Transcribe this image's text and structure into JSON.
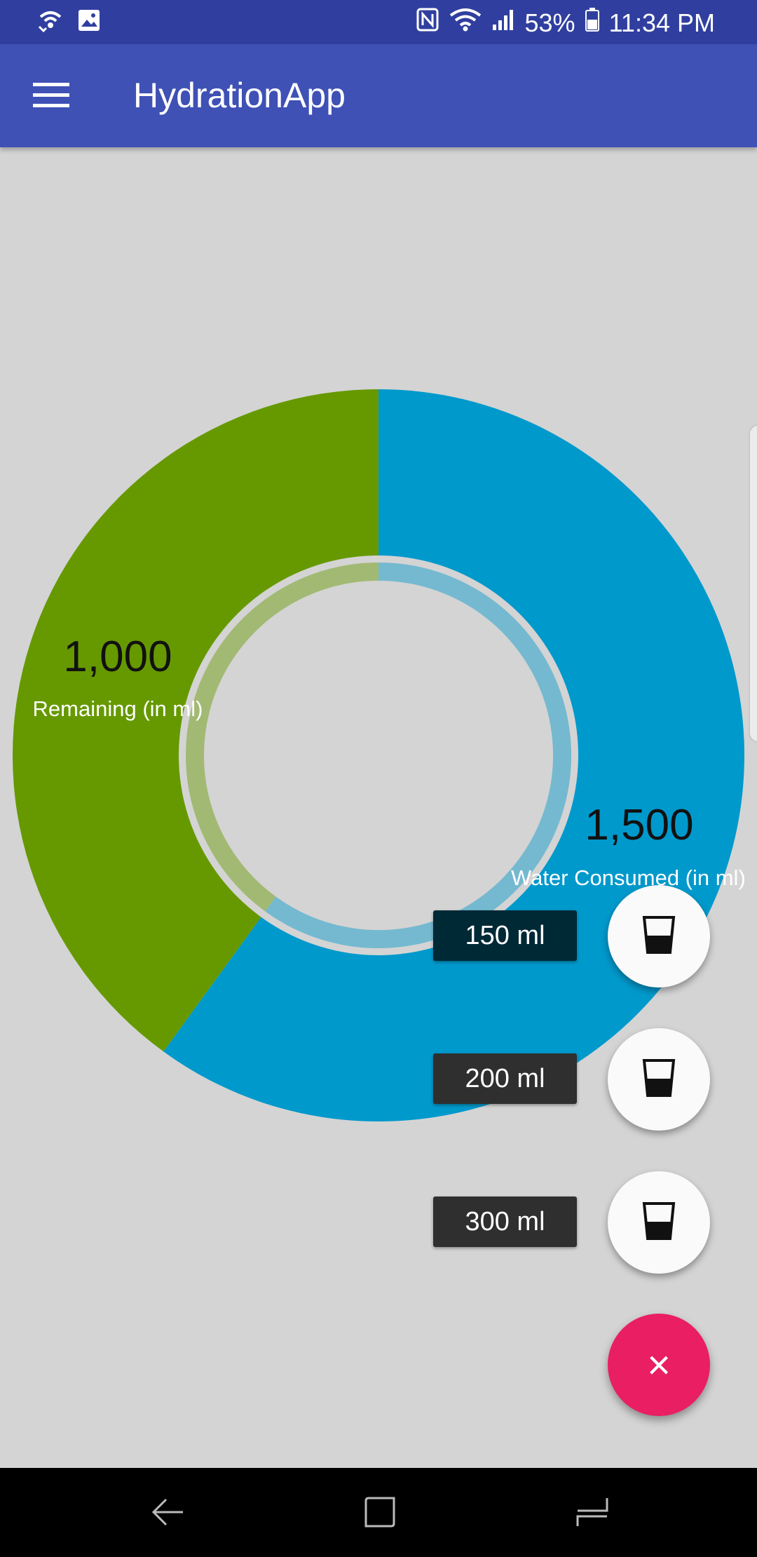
{
  "status_bar": {
    "battery": "53%",
    "time": "11:34 PM",
    "icons": [
      "wifi-calling-icon",
      "image-icon",
      "nfc-icon",
      "wifi-icon",
      "signal-icon",
      "battery-icon"
    ]
  },
  "app_bar": {
    "title": "HydrationApp",
    "menu_icon": "hamburger-menu-icon"
  },
  "chart_data": {
    "type": "pie",
    "labels": [
      "Water Consumed (in ml)",
      "Remaining (in ml)"
    ],
    "values": [
      1500,
      1000
    ],
    "value_labels": [
      "1,500",
      "1,000"
    ],
    "colors": [
      "#0099cc",
      "#669900"
    ]
  },
  "speed_dial": {
    "options": [
      {
        "label": "150 ml",
        "icon": "glass-icon"
      },
      {
        "label": "200 ml",
        "icon": "glass-icon"
      },
      {
        "label": "300 ml",
        "icon": "glass-icon"
      }
    ],
    "close_icon": "close-icon",
    "close_label": "×"
  },
  "nav_bar": {
    "icons": [
      "back-icon",
      "home-icon",
      "recents-icon"
    ]
  }
}
